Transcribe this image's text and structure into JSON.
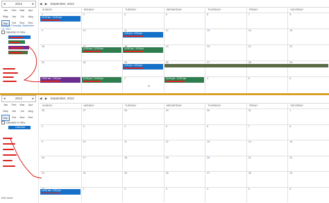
{
  "top": {
    "year": "2012",
    "months": [
      "Jan",
      "Feb",
      "Mar",
      "Apr",
      "May",
      "Jun",
      "Jul",
      "Aug",
      "Sep",
      "Oct",
      "Nov",
      "Dec"
    ],
    "selected_month": "Sep",
    "today_text": "Today is Thursday, September 13, 2012",
    "calendars_in_view": "Calendars in View",
    "nav_prev": "◀",
    "nav_next": "▶",
    "title": "September, 2012",
    "days": [
      "SUNDAY",
      "MONDAY",
      "TUESDAY",
      "WEDNESDAY",
      "THURSDAY",
      "FRIDAY",
      "SATURDAY"
    ],
    "week_rows": [
      [
        "2",
        "3",
        "4",
        "5",
        "6",
        "7",
        "8"
      ],
      [
        "9",
        "10",
        "11",
        "12",
        "13",
        "14",
        "15"
      ],
      [
        "16",
        "17",
        "18",
        "19",
        "20",
        "21",
        "22"
      ],
      [
        "23",
        "24",
        "25",
        "26",
        "27",
        "28",
        "29"
      ],
      [
        "30",
        "1",
        "2",
        "3",
        "4",
        "5",
        "6"
      ]
    ],
    "events": [
      {
        "text": "11:00 am - 12:00 pm"
      },
      {
        "text": "1:00 pm - 5:00 pm"
      },
      {
        "text": "12:00 am - 12:00 am"
      },
      {
        "text": "12:00 am - 1:00 pm"
      },
      {
        "text": "2:00 pm - 3:00 pm"
      },
      {
        "text": "10:00 am - 2:00 pm"
      },
      {
        "text": "12:00 pm - 12:00 pm"
      },
      {
        "text": "12:00 pm - 12:00 am"
      }
    ],
    "more_text": "+2",
    "add_text": "Add"
  },
  "bottom": {
    "year": "2012",
    "months": [
      "Jan",
      "Feb",
      "Mar",
      "Apr",
      "May",
      "Jun",
      "Jul",
      "Aug",
      "Sep",
      "Oct",
      "Nov",
      "Dec"
    ],
    "selected_month": "Sep",
    "calendars_in_view": "Calendars in View",
    "calendar_chip": "Calendar",
    "nav_prev": "◀",
    "nav_next": "▶",
    "title": "September, 2012",
    "days": [
      "SUNDAY",
      "MONDAY",
      "TUESDAY",
      "WEDNESDAY",
      "THURSDAY",
      "FRIDAY",
      "SATURDAY"
    ],
    "week_rows": [
      [
        "26",
        "27",
        "28",
        "29",
        "30",
        "31",
        "1"
      ],
      [
        "2",
        "3",
        "4",
        "5",
        "6",
        "7",
        "8"
      ],
      [
        "9",
        "10",
        "11",
        "12",
        "13",
        "14",
        "15"
      ],
      [
        "16",
        "17",
        "18",
        "19",
        "20",
        "21",
        "22"
      ],
      [
        "23",
        "24",
        "25",
        "26",
        "27",
        "28",
        "29"
      ],
      [
        "30",
        "1",
        "2",
        "3",
        "4",
        "5",
        "6"
      ]
    ],
    "events": [
      {
        "text": "10:00 am - 2:00 pm"
      }
    ],
    "add_text": "Edit Views"
  },
  "colors": {
    "blue": "#1570c8",
    "green": "#2f7d4f",
    "purple": "#6b2e8f",
    "olive": "#5a6b45",
    "red": "#d8231f",
    "divider": "#d9a12b"
  }
}
